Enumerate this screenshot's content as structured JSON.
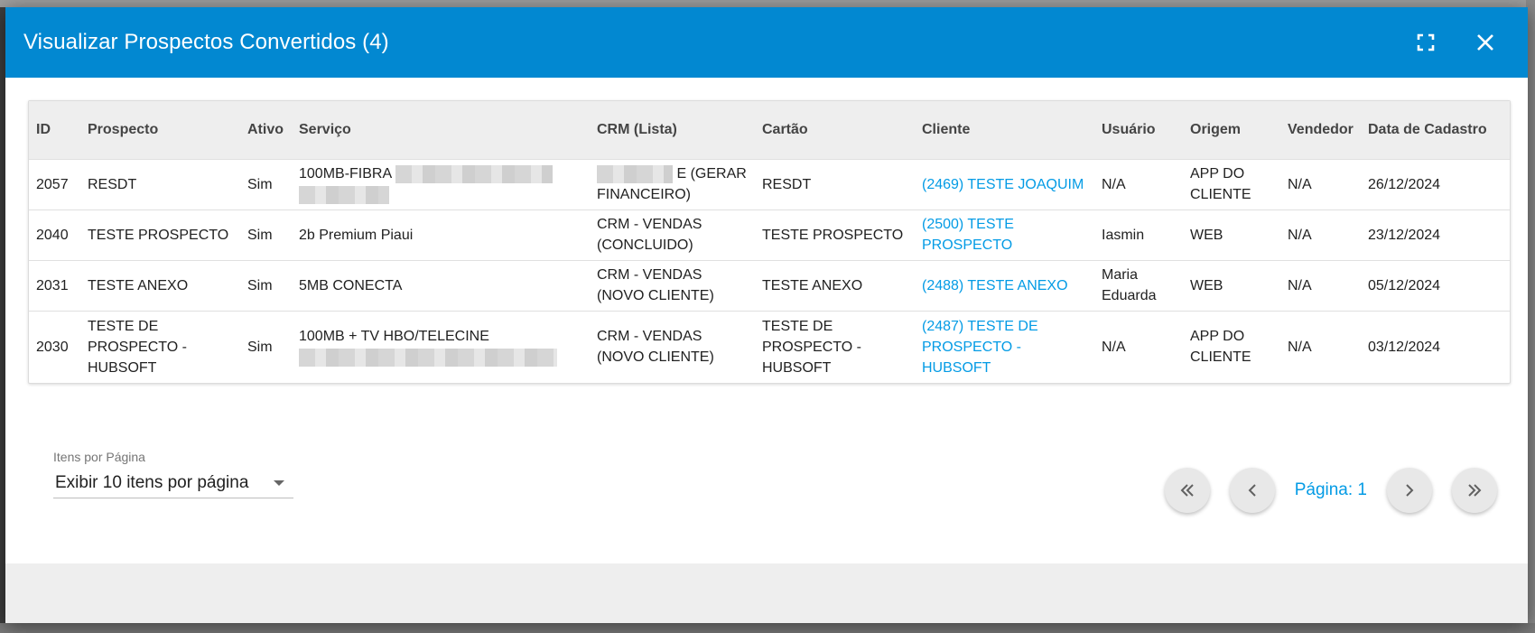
{
  "modal": {
    "title": "Visualizar Prospectos Convertidos (4)"
  },
  "header_icons": {
    "fullscreen": "fullscreen-icon",
    "close": "close-icon"
  },
  "table": {
    "columns": [
      "ID",
      "Prospecto",
      "Ativo",
      "Serviço",
      "CRM (Lista)",
      "Cartão",
      "Cliente",
      "Usuário",
      "Origem",
      "Vendedor",
      "Data de Cadastro"
    ],
    "rows": [
      {
        "id": "2057",
        "prospecto": "RESDT",
        "ativo": "Sim",
        "servico": "100MB-FIBRA",
        "crm": "E (GERAR FINANCEIRO)",
        "cartao": "RESDT",
        "cliente": "(2469) TESTE JOAQUIM",
        "usuario": "N/A",
        "origem": "APP DO CLIENTE",
        "vendedor": "N/A",
        "data": "26/12/2024"
      },
      {
        "id": "2040",
        "prospecto": "TESTE PROSPECTO",
        "ativo": "Sim",
        "servico": "2b Premium Piaui",
        "crm": "CRM - VENDAS (CONCLUIDO)",
        "cartao": "TESTE PROSPECTO",
        "cliente": "(2500) TESTE PROSPECTO",
        "usuario": "Iasmin",
        "origem": "WEB",
        "vendedor": "N/A",
        "data": "23/12/2024"
      },
      {
        "id": "2031",
        "prospecto": "TESTE ANEXO",
        "ativo": "Sim",
        "servico": "5MB CONECTA",
        "crm": "CRM - VENDAS (NOVO CLIENTE)",
        "cartao": "TESTE ANEXO",
        "cliente": "(2488) TESTE ANEXO",
        "usuario": "Maria Eduarda",
        "origem": "WEB",
        "vendedor": "N/A",
        "data": "05/12/2024"
      },
      {
        "id": "2030",
        "prospecto": "TESTE DE PROSPECTO - HUBSOFT",
        "ativo": "Sim",
        "servico": "100MB + TV HBO/TELECINE",
        "crm": "CRM - VENDAS (NOVO CLIENTE)",
        "cartao": "TESTE DE PROSPECTO - HUBSOFT",
        "cliente": "(2487) TESTE DE PROSPECTO - HUBSOFT",
        "usuario": "N/A",
        "origem": "APP DO CLIENTE",
        "vendedor": "N/A",
        "data": "03/12/2024"
      }
    ]
  },
  "pagination": {
    "items_label": "Itens por Página",
    "items_value": "Exibir 10 itens por página",
    "page_label": "Página: 1"
  },
  "colors": {
    "header": "#0288d1",
    "link": "#039be5"
  }
}
